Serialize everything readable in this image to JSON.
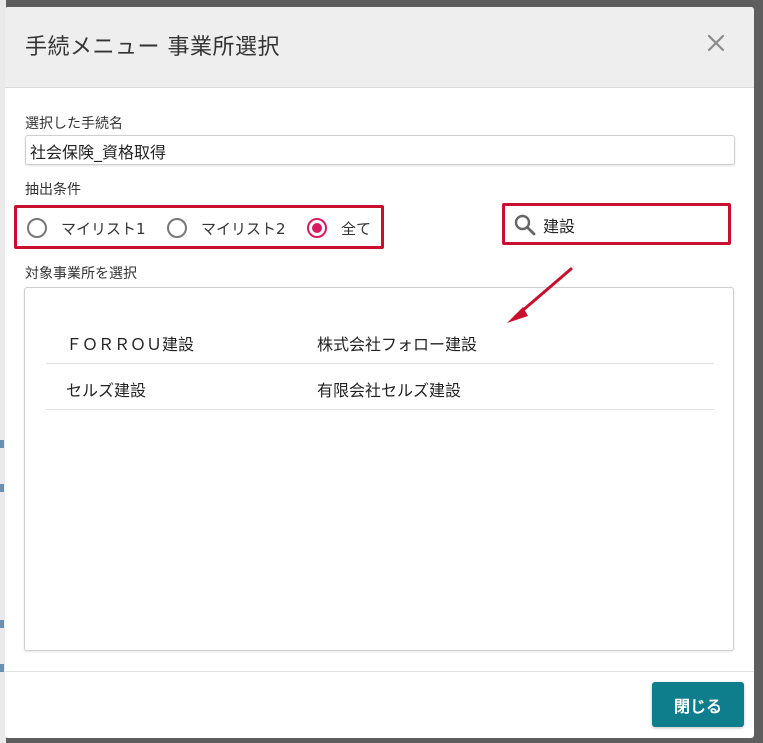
{
  "dialog": {
    "title": "手続メニュー 事業所選択"
  },
  "selected_procedure": {
    "label": "選択した手続名",
    "value": "社会保険_資格取得"
  },
  "filter": {
    "label": "抽出条件",
    "options": [
      {
        "label": "マイリスト1",
        "selected": false
      },
      {
        "label": "マイリスト2",
        "selected": false
      },
      {
        "label": "全て",
        "selected": true
      }
    ]
  },
  "search": {
    "value": "建設"
  },
  "office_list": {
    "label": "対象事業所を選択",
    "rows": [
      {
        "short_name": "ＦＯＲＲＯＵ建設",
        "full_name": "株式会社フォロー建設"
      },
      {
        "short_name": "セルズ建設",
        "full_name": "有限会社セルズ建設"
      }
    ]
  },
  "footer": {
    "close_label": "閉じる"
  },
  "colors": {
    "highlight": "#c8102e",
    "radio_active": "#d81b60",
    "primary_button": "#0e7d8c"
  }
}
